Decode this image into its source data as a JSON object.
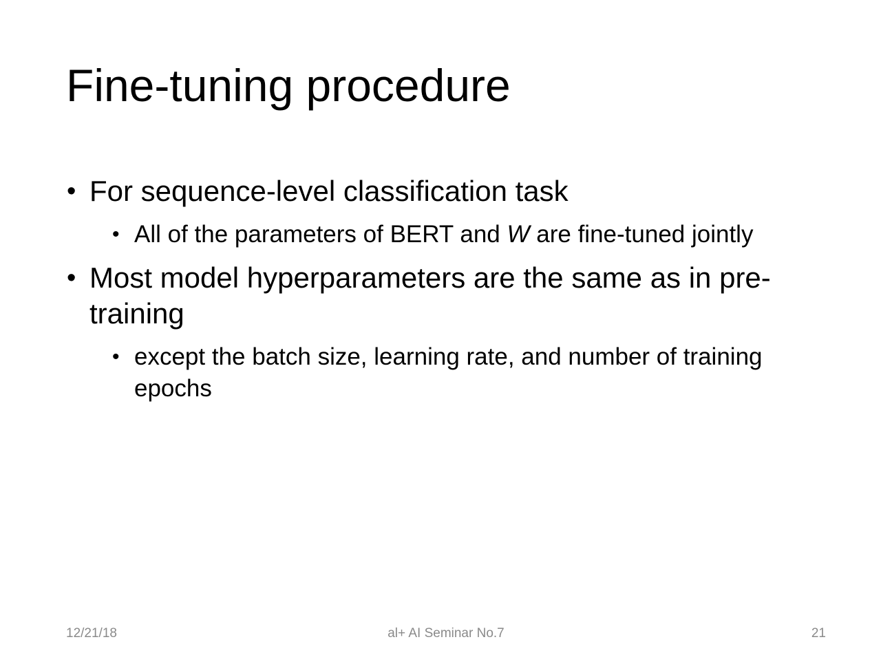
{
  "slide": {
    "title": "Fine-tuning procedure",
    "bullets": [
      {
        "text": "For sequence-level classification task",
        "sub": [
          {
            "before": "All of the parameters of BERT and ",
            "italic": "W",
            "after": " are fine-tuned jointly"
          }
        ]
      },
      {
        "text": "Most model hyperparameters are the same as in pre-training",
        "sub": [
          {
            "text": "except the batch size, learning rate, and number of training epochs"
          }
        ]
      }
    ],
    "bullet_glyph": "•"
  },
  "footer": {
    "date": "12/21/18",
    "center": "al+ AI Seminar No.7",
    "page": "21"
  },
  "colors": {
    "background": "#ffffff",
    "text": "#000000",
    "footer_text": "#8a8a8a"
  }
}
